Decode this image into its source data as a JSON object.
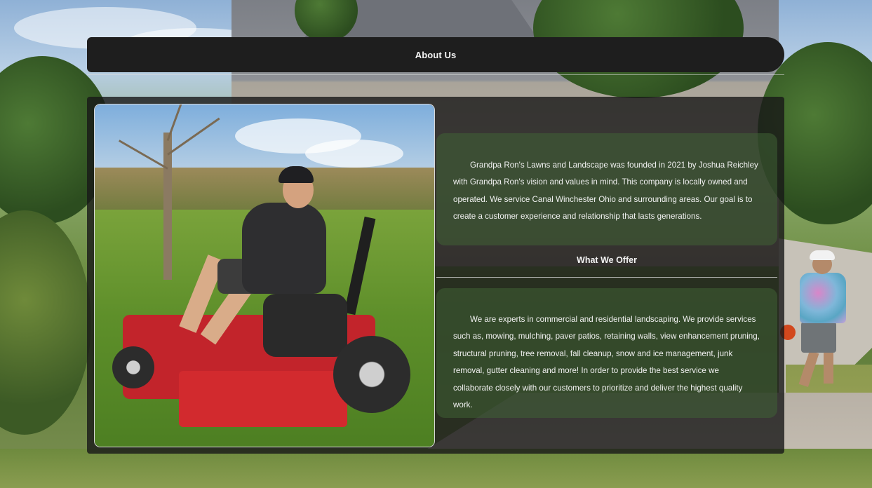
{
  "header": {
    "title": "About Us"
  },
  "about": {
    "paragraph": "Grandpa Ron's Lawns and Landscape was founded in 2021 by Joshua Reichley with Grandpa Ron's vision and values in mind. This company is locally owned and operated. We service Canal Winchester Ohio and surrounding areas. Our goal is to create a customer experience and relationship that lasts generations."
  },
  "offer": {
    "heading": "What We Offer",
    "paragraph": "We are experts in commercial and residential landscaping. We provide services such as, mowing, mulching, paver patios, retaining walls, view enhancement pruning, structural pruning, tree removal, fall cleanup, snow and ice management, junk removal, gutter cleaning and more! In order to provide the best service we collaborate closely with our customers to prioritize and deliver the highest quality work."
  },
  "colors": {
    "header_bg": "#1e1e1e",
    "panel_bg": "#181818",
    "card_bg": "#406234",
    "text": "#f1f1f1"
  }
}
